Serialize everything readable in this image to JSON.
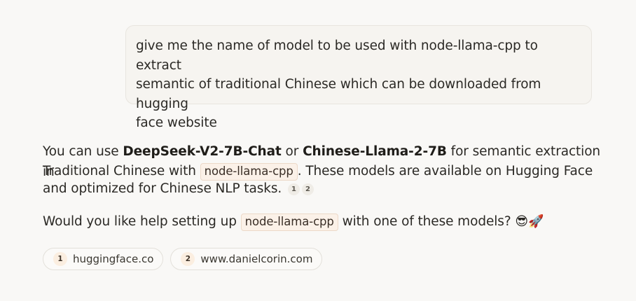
{
  "user_message": {
    "line1": "give me the name of model to be used with node-llama-cpp to extract",
    "line2": "semantic of traditional Chinese which can be downloaded from hugging",
    "line3": "face website"
  },
  "assistant": {
    "p1": {
      "t1": "You can use ",
      "model1": "DeepSeek-V2-7B-Chat",
      "t2": " or ",
      "model2": "Chinese-Llama-2-7B",
      "t3": " for semantic extraction in",
      "t4": "Traditional Chinese with ",
      "code": "node-llama-cpp",
      "t5": ". These models are available on Hugging Face",
      "t6": "and optimized for Chinese NLP tasks.",
      "cite1": "1",
      "cite2": "2"
    },
    "p2": {
      "t1": "Would you like help setting up ",
      "code": "node-llama-cpp",
      "t2": " with one of these models? ",
      "emoji1": "😎",
      "emoji2": "🚀"
    }
  },
  "sources": [
    {
      "num": "1",
      "label": "huggingface.co"
    },
    {
      "num": "2",
      "label": "www.danielcorin.com"
    }
  ]
}
